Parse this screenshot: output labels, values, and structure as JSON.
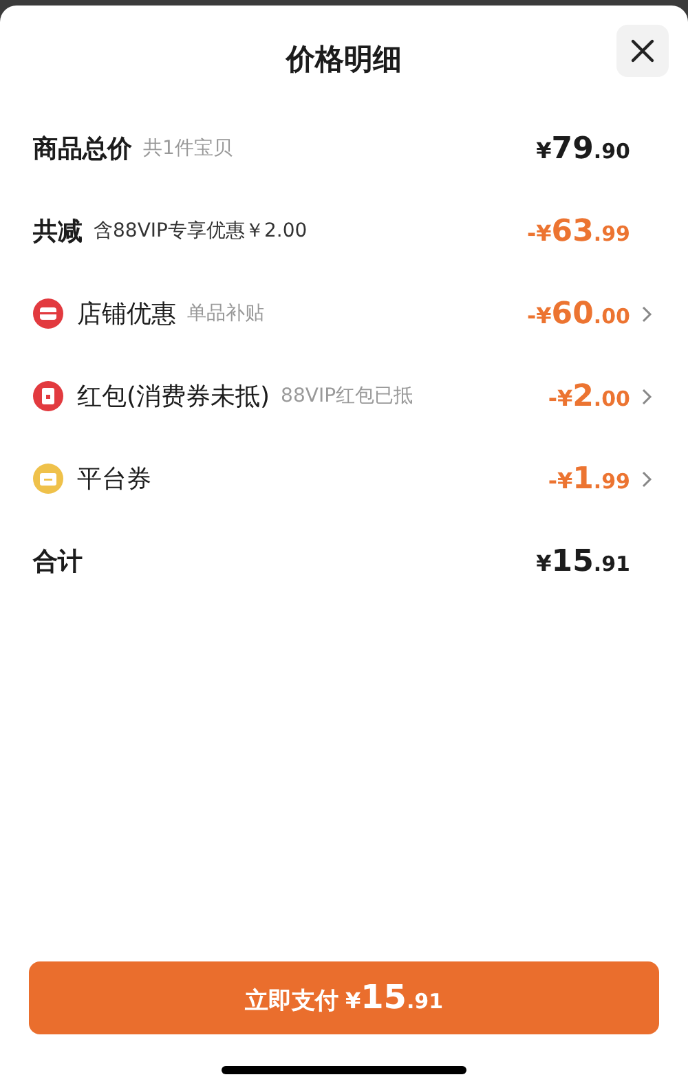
{
  "title": "价格明细",
  "rows": [
    {
      "kind": "total",
      "label": "商品总价",
      "note": "共1件宝贝",
      "amount": "¥79.90"
    },
    {
      "kind": "discount",
      "label": "共减",
      "note": "含88VIP专享优惠￥2.00",
      "amount": "-¥63.99"
    },
    {
      "kind": "store",
      "label": "店铺优惠",
      "note": "单品补贴",
      "amount": "-¥60.00",
      "color": "#e23a3f"
    },
    {
      "kind": "packet",
      "label": "红包(消费券未抵)",
      "note": "88VIP红包已抵",
      "amount": "-¥2.00",
      "color": "#e23a3f"
    },
    {
      "kind": "ticket",
      "label": "平台券",
      "amount": "-¥1.99",
      "color": "#efc14a"
    },
    {
      "kind": "sum",
      "label": "合计",
      "amount": "¥15.91"
    }
  ],
  "pay_button": {
    "label": "立即支付",
    "amount": "¥15.91"
  }
}
